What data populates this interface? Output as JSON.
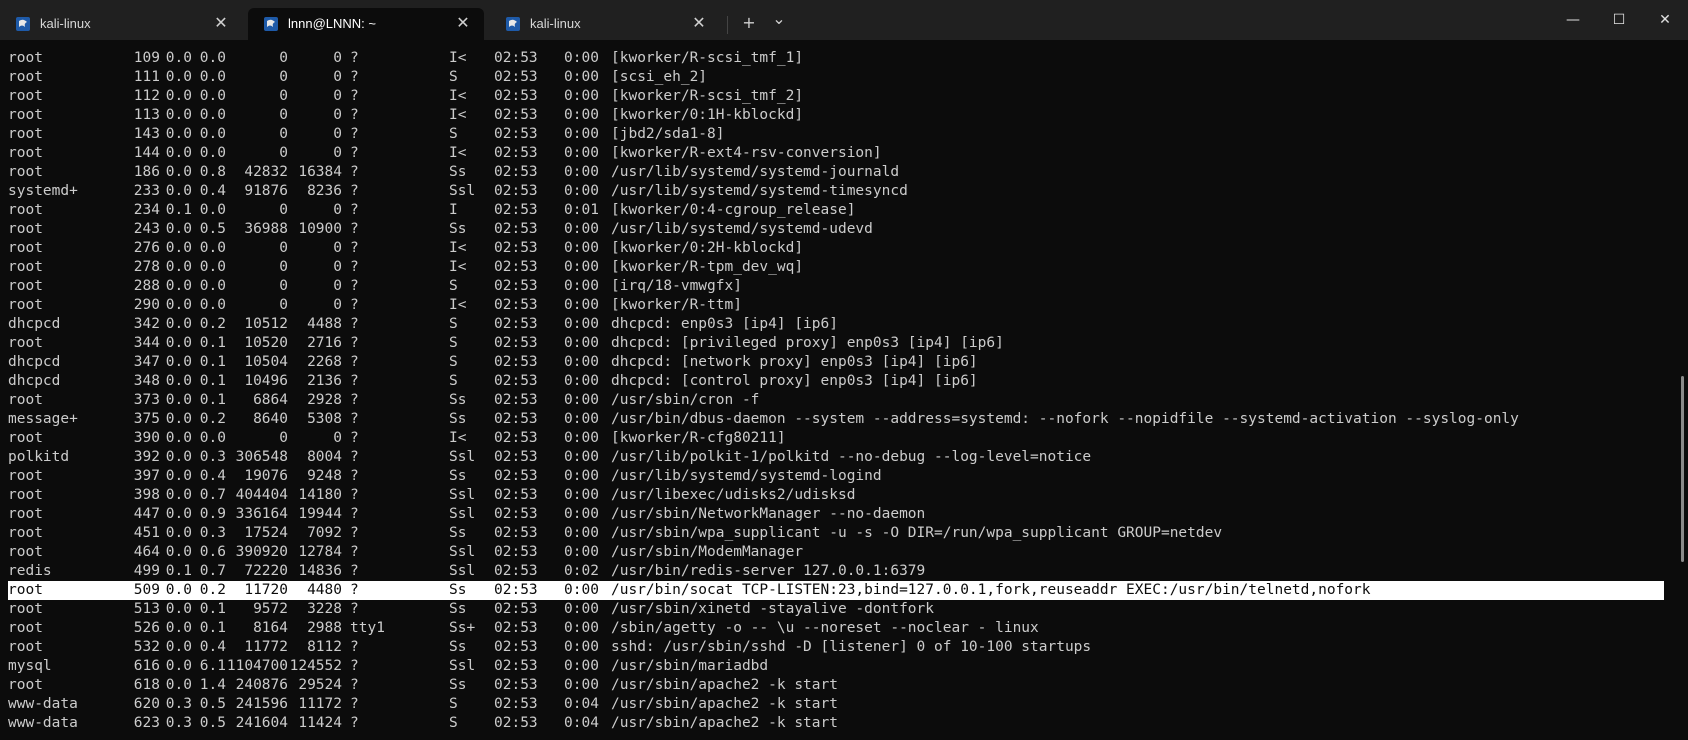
{
  "tabs": [
    {
      "title": "kali-linux",
      "icon": "kali-icon",
      "active": false
    },
    {
      "title": "lnnn@LNNN: ~",
      "icon": "kali-icon",
      "active": true
    },
    {
      "title": "kali-linux",
      "icon": "kali-icon",
      "active": false
    }
  ],
  "toolbar": {
    "new_tab": "+",
    "dropdown": "⌄"
  },
  "window_controls": {
    "minimize": "—",
    "maximize": "☐",
    "close": "✕"
  },
  "process_rows": [
    {
      "user": "root",
      "pid": "109",
      "cpu": "0.0",
      "mem": "0.0",
      "vsz": "0",
      "rss": "0",
      "tty": "?",
      "stat": "I<",
      "start": "02:53",
      "time": "0:00",
      "command": "[kworker/R-scsi_tmf_1]"
    },
    {
      "user": "root",
      "pid": "111",
      "cpu": "0.0",
      "mem": "0.0",
      "vsz": "0",
      "rss": "0",
      "tty": "?",
      "stat": "S",
      "start": "02:53",
      "time": "0:00",
      "command": "[scsi_eh_2]"
    },
    {
      "user": "root",
      "pid": "112",
      "cpu": "0.0",
      "mem": "0.0",
      "vsz": "0",
      "rss": "0",
      "tty": "?",
      "stat": "I<",
      "start": "02:53",
      "time": "0:00",
      "command": "[kworker/R-scsi_tmf_2]"
    },
    {
      "user": "root",
      "pid": "113",
      "cpu": "0.0",
      "mem": "0.0",
      "vsz": "0",
      "rss": "0",
      "tty": "?",
      "stat": "I<",
      "start": "02:53",
      "time": "0:00",
      "command": "[kworker/0:1H-kblockd]"
    },
    {
      "user": "root",
      "pid": "143",
      "cpu": "0.0",
      "mem": "0.0",
      "vsz": "0",
      "rss": "0",
      "tty": "?",
      "stat": "S",
      "start": "02:53",
      "time": "0:00",
      "command": "[jbd2/sda1-8]"
    },
    {
      "user": "root",
      "pid": "144",
      "cpu": "0.0",
      "mem": "0.0",
      "vsz": "0",
      "rss": "0",
      "tty": "?",
      "stat": "I<",
      "start": "02:53",
      "time": "0:00",
      "command": "[kworker/R-ext4-rsv-conversion]"
    },
    {
      "user": "root",
      "pid": "186",
      "cpu": "0.0",
      "mem": "0.8",
      "vsz": "42832",
      "rss": "16384",
      "tty": "?",
      "stat": "Ss",
      "start": "02:53",
      "time": "0:00",
      "command": "/usr/lib/systemd/systemd-journald"
    },
    {
      "user": "systemd+",
      "pid": "233",
      "cpu": "0.0",
      "mem": "0.4",
      "vsz": "91876",
      "rss": "8236",
      "tty": "?",
      "stat": "Ssl",
      "start": "02:53",
      "time": "0:00",
      "command": "/usr/lib/systemd/systemd-timesyncd"
    },
    {
      "user": "root",
      "pid": "234",
      "cpu": "0.1",
      "mem": "0.0",
      "vsz": "0",
      "rss": "0",
      "tty": "?",
      "stat": "I",
      "start": "02:53",
      "time": "0:01",
      "command": "[kworker/0:4-cgroup_release]"
    },
    {
      "user": "root",
      "pid": "243",
      "cpu": "0.0",
      "mem": "0.5",
      "vsz": "36988",
      "rss": "10900",
      "tty": "?",
      "stat": "Ss",
      "start": "02:53",
      "time": "0:00",
      "command": "/usr/lib/systemd/systemd-udevd"
    },
    {
      "user": "root",
      "pid": "276",
      "cpu": "0.0",
      "mem": "0.0",
      "vsz": "0",
      "rss": "0",
      "tty": "?",
      "stat": "I<",
      "start": "02:53",
      "time": "0:00",
      "command": "[kworker/0:2H-kblockd]"
    },
    {
      "user": "root",
      "pid": "278",
      "cpu": "0.0",
      "mem": "0.0",
      "vsz": "0",
      "rss": "0",
      "tty": "?",
      "stat": "I<",
      "start": "02:53",
      "time": "0:00",
      "command": "[kworker/R-tpm_dev_wq]"
    },
    {
      "user": "root",
      "pid": "288",
      "cpu": "0.0",
      "mem": "0.0",
      "vsz": "0",
      "rss": "0",
      "tty": "?",
      "stat": "S",
      "start": "02:53",
      "time": "0:00",
      "command": "[irq/18-vmwgfx]"
    },
    {
      "user": "root",
      "pid": "290",
      "cpu": "0.0",
      "mem": "0.0",
      "vsz": "0",
      "rss": "0",
      "tty": "?",
      "stat": "I<",
      "start": "02:53",
      "time": "0:00",
      "command": "[kworker/R-ttm]"
    },
    {
      "user": "dhcpcd",
      "pid": "342",
      "cpu": "0.0",
      "mem": "0.2",
      "vsz": "10512",
      "rss": "4488",
      "tty": "?",
      "stat": "S",
      "start": "02:53",
      "time": "0:00",
      "command": "dhcpcd: enp0s3 [ip4] [ip6]"
    },
    {
      "user": "root",
      "pid": "344",
      "cpu": "0.0",
      "mem": "0.1",
      "vsz": "10520",
      "rss": "2716",
      "tty": "?",
      "stat": "S",
      "start": "02:53",
      "time": "0:00",
      "command": "dhcpcd: [privileged proxy] enp0s3 [ip4] [ip6]"
    },
    {
      "user": "dhcpcd",
      "pid": "347",
      "cpu": "0.0",
      "mem": "0.1",
      "vsz": "10504",
      "rss": "2268",
      "tty": "?",
      "stat": "S",
      "start": "02:53",
      "time": "0:00",
      "command": "dhcpcd: [network proxy] enp0s3 [ip4] [ip6]"
    },
    {
      "user": "dhcpcd",
      "pid": "348",
      "cpu": "0.0",
      "mem": "0.1",
      "vsz": "10496",
      "rss": "2136",
      "tty": "?",
      "stat": "S",
      "start": "02:53",
      "time": "0:00",
      "command": "dhcpcd: [control proxy] enp0s3 [ip4] [ip6]"
    },
    {
      "user": "root",
      "pid": "373",
      "cpu": "0.0",
      "mem": "0.1",
      "vsz": "6864",
      "rss": "2928",
      "tty": "?",
      "stat": "Ss",
      "start": "02:53",
      "time": "0:00",
      "command": "/usr/sbin/cron -f"
    },
    {
      "user": "message+",
      "pid": "375",
      "cpu": "0.0",
      "mem": "0.2",
      "vsz": "8640",
      "rss": "5308",
      "tty": "?",
      "stat": "Ss",
      "start": "02:53",
      "time": "0:00",
      "command": "/usr/bin/dbus-daemon --system --address=systemd: --nofork --nopidfile --systemd-activation --syslog-only"
    },
    {
      "user": "root",
      "pid": "390",
      "cpu": "0.0",
      "mem": "0.0",
      "vsz": "0",
      "rss": "0",
      "tty": "?",
      "stat": "I<",
      "start": "02:53",
      "time": "0:00",
      "command": "[kworker/R-cfg80211]"
    },
    {
      "user": "polkitd",
      "pid": "392",
      "cpu": "0.0",
      "mem": "0.3",
      "vsz": "306548",
      "rss": "8004",
      "tty": "?",
      "stat": "Ssl",
      "start": "02:53",
      "time": "0:00",
      "command": "/usr/lib/polkit-1/polkitd --no-debug --log-level=notice"
    },
    {
      "user": "root",
      "pid": "397",
      "cpu": "0.0",
      "mem": "0.4",
      "vsz": "19076",
      "rss": "9248",
      "tty": "?",
      "stat": "Ss",
      "start": "02:53",
      "time": "0:00",
      "command": "/usr/lib/systemd/systemd-logind"
    },
    {
      "user": "root",
      "pid": "398",
      "cpu": "0.0",
      "mem": "0.7",
      "vsz": "404404",
      "rss": "14180",
      "tty": "?",
      "stat": "Ssl",
      "start": "02:53",
      "time": "0:00",
      "command": "/usr/libexec/udisks2/udisksd"
    },
    {
      "user": "root",
      "pid": "447",
      "cpu": "0.0",
      "mem": "0.9",
      "vsz": "336164",
      "rss": "19944",
      "tty": "?",
      "stat": "Ssl",
      "start": "02:53",
      "time": "0:00",
      "command": "/usr/sbin/NetworkManager --no-daemon"
    },
    {
      "user": "root",
      "pid": "451",
      "cpu": "0.0",
      "mem": "0.3",
      "vsz": "17524",
      "rss": "7092",
      "tty": "?",
      "stat": "Ss",
      "start": "02:53",
      "time": "0:00",
      "command": "/usr/sbin/wpa_supplicant -u -s -O DIR=/run/wpa_supplicant GROUP=netdev"
    },
    {
      "user": "root",
      "pid": "464",
      "cpu": "0.0",
      "mem": "0.6",
      "vsz": "390920",
      "rss": "12784",
      "tty": "?",
      "stat": "Ssl",
      "start": "02:53",
      "time": "0:00",
      "command": "/usr/sbin/ModemManager"
    },
    {
      "user": "redis",
      "pid": "499",
      "cpu": "0.1",
      "mem": "0.7",
      "vsz": "72220",
      "rss": "14836",
      "tty": "?",
      "stat": "Ssl",
      "start": "02:53",
      "time": "0:02",
      "command": "/usr/bin/redis-server 127.0.0.1:6379"
    },
    {
      "user": "root",
      "pid": "509",
      "cpu": "0.0",
      "mem": "0.2",
      "vsz": "11720",
      "rss": "4480",
      "tty": "?",
      "stat": "Ss",
      "start": "02:53",
      "time": "0:00",
      "command": "/usr/bin/socat TCP-LISTEN:23,bind=127.0.0.1,fork,reuseaddr EXEC:/usr/bin/telnetd,nofork",
      "selected": true
    },
    {
      "user": "root",
      "pid": "513",
      "cpu": "0.0",
      "mem": "0.1",
      "vsz": "9572",
      "rss": "3228",
      "tty": "?",
      "stat": "Ss",
      "start": "02:53",
      "time": "0:00",
      "command": "/usr/sbin/xinetd -stayalive -dontfork"
    },
    {
      "user": "root",
      "pid": "526",
      "cpu": "0.0",
      "mem": "0.1",
      "vsz": "8164",
      "rss": "2988",
      "tty": "tty1",
      "stat": "Ss+",
      "start": "02:53",
      "time": "0:00",
      "command": "/sbin/agetty -o -- \\u --noreset --noclear - linux"
    },
    {
      "user": "root",
      "pid": "532",
      "cpu": "0.0",
      "mem": "0.4",
      "vsz": "11772",
      "rss": "8112",
      "tty": "?",
      "stat": "Ss",
      "start": "02:53",
      "time": "0:00",
      "command": "sshd: /usr/sbin/sshd -D [listener] 0 of 10-100 startups"
    },
    {
      "user": "mysql",
      "pid": "616",
      "cpu": "0.0",
      "mem": "6.1",
      "vsz": "1104700",
      "rss": "124552",
      "tty": "?",
      "stat": "Ssl",
      "start": "02:53",
      "time": "0:00",
      "command": "/usr/sbin/mariadbd"
    },
    {
      "user": "root",
      "pid": "618",
      "cpu": "0.0",
      "mem": "1.4",
      "vsz": "240876",
      "rss": "29524",
      "tty": "?",
      "stat": "Ss",
      "start": "02:53",
      "time": "0:00",
      "command": "/usr/sbin/apache2 -k start"
    },
    {
      "user": "www-data",
      "pid": "620",
      "cpu": "0.3",
      "mem": "0.5",
      "vsz": "241596",
      "rss": "11172",
      "tty": "?",
      "stat": "S",
      "start": "02:53",
      "time": "0:04",
      "command": "/usr/sbin/apache2 -k start"
    },
    {
      "user": "www-data",
      "pid": "623",
      "cpu": "0.3",
      "mem": "0.5",
      "vsz": "241604",
      "rss": "11424",
      "tty": "?",
      "stat": "S",
      "start": "02:53",
      "time": "0:04",
      "command": "/usr/sbin/apache2 -k start"
    }
  ]
}
